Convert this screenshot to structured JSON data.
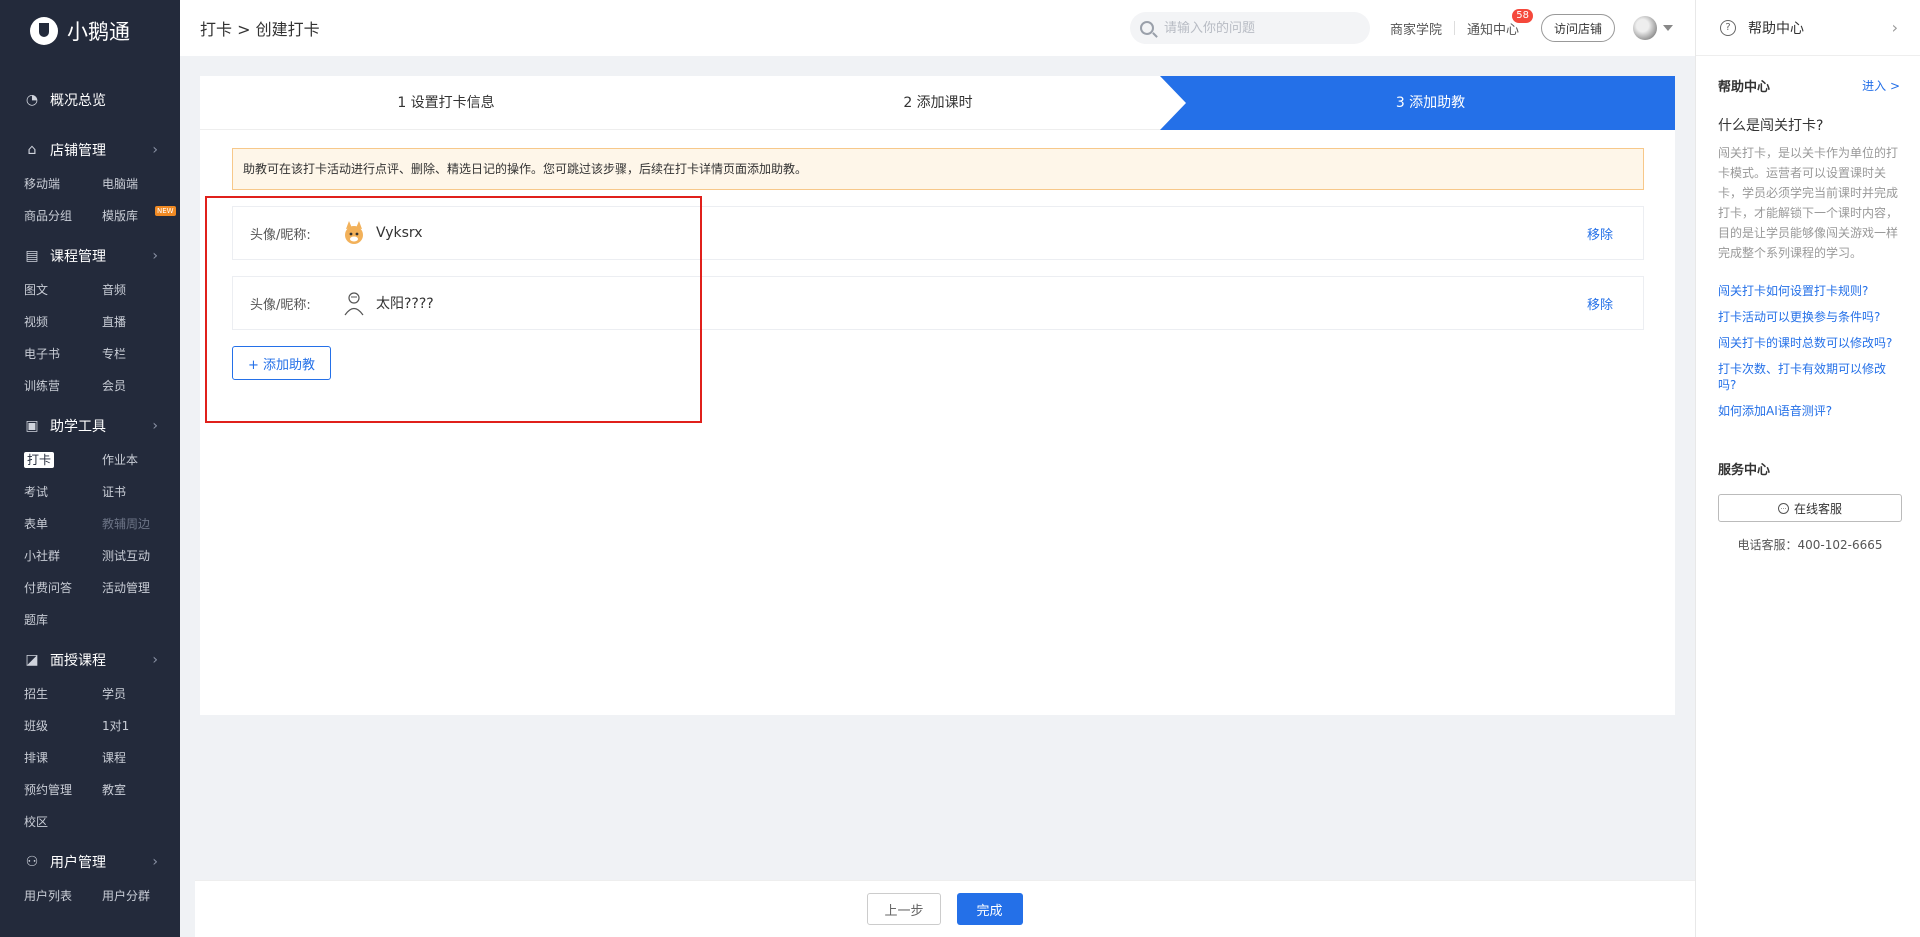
{
  "logo": {
    "text": "小鹅通"
  },
  "sidebar": {
    "groups": [
      {
        "title": "概况总览",
        "icon": "dashboard-icon",
        "items": []
      },
      {
        "title": "店铺管理",
        "icon": "store-icon",
        "items": [
          "移动端",
          "电脑端",
          "商品分组",
          "模版库"
        ],
        "badge": "NEW"
      },
      {
        "title": "课程管理",
        "icon": "course-icon",
        "items": [
          "图文",
          "音频",
          "视频",
          "直播",
          "电子书",
          "专栏",
          "训练营",
          "会员"
        ]
      },
      {
        "title": "助学工具",
        "icon": "toolbox-icon",
        "items": [
          "打卡",
          "作业本",
          "考试",
          "证书",
          "表单",
          "教辅周边",
          "小社群",
          "测试互动",
          "付费问答",
          "活动管理",
          "题库"
        ]
      },
      {
        "title": "面授课程",
        "icon": "classroom-icon",
        "items": [
          "招生",
          "学员",
          "班级",
          "1对1",
          "排课",
          "课程",
          "预约管理",
          "教室",
          "校区"
        ]
      },
      {
        "title": "用户管理",
        "icon": "user-icon",
        "items": [
          "用户列表",
          "用户分群"
        ]
      }
    ]
  },
  "header": {
    "breadcrumb": "打卡 > 创建打卡",
    "search_placeholder": "请输入你的问题",
    "academy": "商家学院",
    "notice": "通知中心",
    "notice_count": "58",
    "visit": "访问店铺"
  },
  "steps": [
    {
      "label": "1 设置打卡信息"
    },
    {
      "label": "2 添加课时"
    },
    {
      "label": "3 添加助教"
    }
  ],
  "alert": "助教可在该打卡活动进行点评、删除、精选日记的操作。您可跳过该步骤，后续在打卡详情页面添加助教。",
  "assistants": [
    {
      "label": "头像/昵称:",
      "name": "Vyksrx",
      "remove": "移除"
    },
    {
      "label": "头像/昵称:",
      "name": "太阳????",
      "remove": "移除"
    }
  ],
  "add_button": "+ 添加助教",
  "footer": {
    "prev": "上一步",
    "done": "完成"
  },
  "help": {
    "top": "帮助中心",
    "section_title": "帮助中心",
    "enter": "进入 >",
    "question": "什么是闯关打卡?",
    "description": "闯关打卡，是以关卡作为单位的打卡模式。运营者可以设置课时关卡，学员必须学完当前课时并完成打卡，才能解锁下一个课时内容，目的是让学员能够像闯关游戏一样完成整个系列课程的学习。",
    "links": [
      "闯关打卡如何设置打卡规则?",
      "打卡活动可以更换参与条件吗?",
      "闯关打卡的课时总数可以修改吗?",
      "打卡次数、打卡有效期可以修改吗?",
      "如何添加AI语音测评?"
    ],
    "service_title": "服务中心",
    "service_button": "在线客服",
    "phone": "电话客服：400-102-6665"
  },
  "colors": {
    "primary": "#2470e8",
    "sidebar": "#232a3b",
    "highlight": "#e0201b",
    "alert_bg": "#fef6e9"
  }
}
